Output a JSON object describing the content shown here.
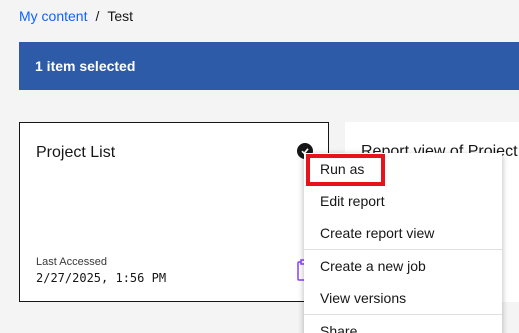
{
  "breadcrumb": {
    "root": "My content",
    "separator": "/",
    "current": "Test"
  },
  "selection_bar": {
    "text": "1 item selected",
    "color": "#2d5ba8"
  },
  "tiles": [
    {
      "title": "Project List",
      "meta_label": "Last Accessed",
      "meta_value": "2/27/2025, 1:56 PM",
      "selected": true
    },
    {
      "title": "Report view of Project"
    }
  ],
  "context_menu": {
    "items": [
      "Run as",
      "Edit report",
      "Create report view",
      "Create a new job",
      "View versions",
      "Share"
    ],
    "highlighted_item": "Run as",
    "highlight_color": "#e8131a"
  }
}
